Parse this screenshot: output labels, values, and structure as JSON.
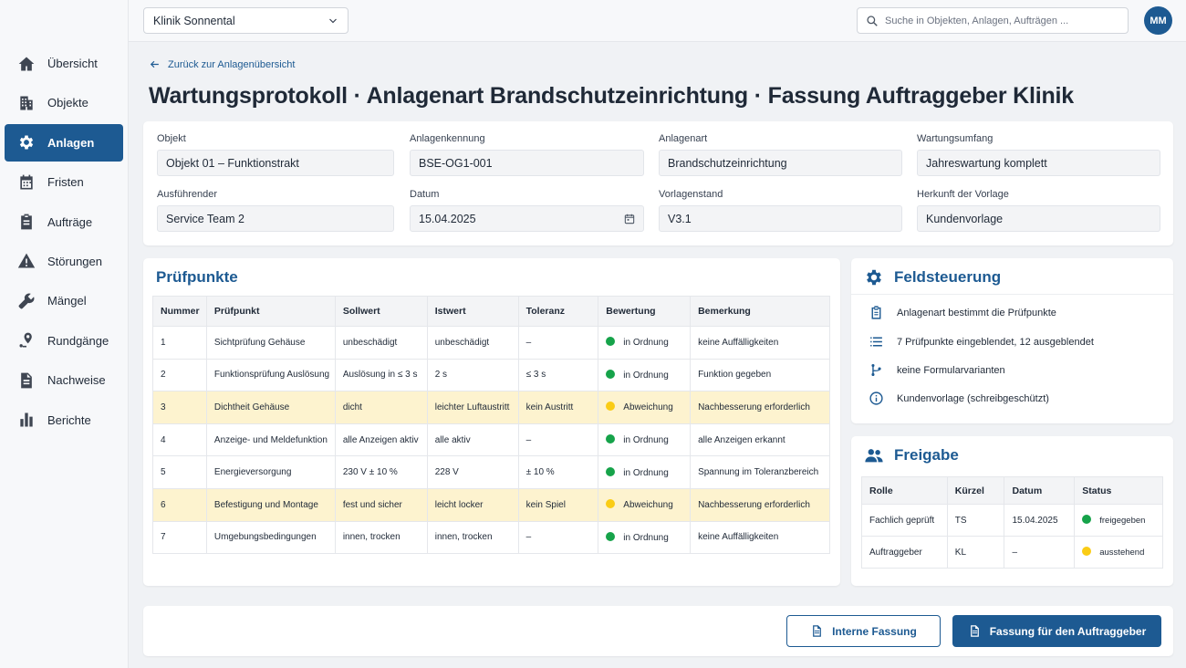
{
  "topbar": {
    "clinic": "Klinik Sonnental",
    "search_placeholder": "Suche in Objekten, Anlagen, Aufträgen ...",
    "avatar_initials": "MM"
  },
  "sidebar": {
    "items": [
      {
        "label": "Übersicht",
        "icon": "home-icon"
      },
      {
        "label": "Objekte",
        "icon": "building-icon"
      },
      {
        "label": "Anlagen",
        "icon": "gear-icon",
        "active": true
      },
      {
        "label": "Fristen",
        "icon": "calendar-icon"
      },
      {
        "label": "Aufträge",
        "icon": "clipboard-icon"
      },
      {
        "label": "Störungen",
        "icon": "warning-icon"
      },
      {
        "label": "Mängel",
        "icon": "wrench-icon"
      },
      {
        "label": "Rundgänge",
        "icon": "route-pin-icon"
      },
      {
        "label": "Nachweise",
        "icon": "document-icon"
      },
      {
        "label": "Berichte",
        "icon": "bar-chart-icon"
      }
    ]
  },
  "page": {
    "back_label": "Zurück zur Anlagenübersicht",
    "title": "Wartungsprotokoll · Anlagenart  Brandschutzeinrichtung · Fassung Auftraggeber Klinik"
  },
  "meta": {
    "objekt": {
      "label": "Objekt",
      "value": "Objekt 01 – Funktionstrakt"
    },
    "anlagenkennung": {
      "label": "Anlagenkennung",
      "value": "BSE-OG1-001"
    },
    "anlagenart": {
      "label": "Anlagenart",
      "value": "Brandschutzeinrichtung"
    },
    "wartungsumfang": {
      "label": "Wartungsumfang",
      "value": "Jahreswartung komplett"
    },
    "ausfuehrender": {
      "label": "Ausführender",
      "value": "Service Team 2"
    },
    "datum": {
      "label": "Datum",
      "value": "15.04.2025"
    },
    "vorlagenstand": {
      "label": "Vorlagenstand",
      "value": "V3.1"
    },
    "herkunft": {
      "label": "Herkunft der Vorlage",
      "value": "Kundenvorlage"
    }
  },
  "checks": {
    "title": "Prüfpunkte",
    "columns": [
      "Nummer",
      "Prüfpunkt",
      "Sollwert",
      "Istwert",
      "Toleranz",
      "Bewertung",
      "Bemerkung"
    ],
    "rows": [
      {
        "nr": "1",
        "punkt": "Sichtprüfung Gehäuse",
        "soll": "unbeschädigt",
        "ist": "unbeschädigt",
        "tol": "–",
        "bew": "in Ordnung",
        "status": "ok",
        "bem": "keine Auffälligkeiten"
      },
      {
        "nr": "2",
        "punkt": "Funktionsprüfung Auslösung",
        "soll": "Auslösung in ≤ 3 s",
        "ist": "2 s",
        "tol": "≤ 3 s",
        "bew": "in Ordnung",
        "status": "ok",
        "bem": "Funktion gegeben"
      },
      {
        "nr": "3",
        "punkt": "Dichtheit Gehäuse",
        "soll": "dicht",
        "ist": "leichter Luftaustritt",
        "tol": "kein Austritt",
        "bew": "Abweichung",
        "status": "warn",
        "bem": "Nachbesserung erforderlich"
      },
      {
        "nr": "4",
        "punkt": "Anzeige- und Meldefunktion",
        "soll": "alle Anzeigen aktiv",
        "ist": "alle aktiv",
        "tol": "–",
        "bew": "in Ordnung",
        "status": "ok",
        "bem": "alle Anzeigen erkannt"
      },
      {
        "nr": "5",
        "punkt": "Energieversorgung",
        "soll": "230 V ± 10 %",
        "ist": "228 V",
        "tol": "± 10 %",
        "bew": "in Ordnung",
        "status": "ok",
        "bem": "Spannung im Toleranzbereich"
      },
      {
        "nr": "6",
        "punkt": "Befestigung und Montage",
        "soll": "fest und sicher",
        "ist": "leicht locker",
        "tol": "kein Spiel",
        "bew": "Abweichung",
        "status": "warn",
        "bem": "Nachbesserung erforderlich"
      },
      {
        "nr": "7",
        "punkt": "Umgebungsbedingungen",
        "soll": "innen, trocken",
        "ist": "innen, trocken",
        "tol": "–",
        "bew": "in Ordnung",
        "status": "ok",
        "bem": "keine Auffälligkeiten"
      }
    ]
  },
  "control": {
    "title": "Feldsteuerung",
    "items": [
      {
        "label": "Anlagenart bestimmt die Prüfpunkte",
        "icon": "clipboard-icon"
      },
      {
        "label": "7 Prüfpunkte eingeblendet, 12 ausgeblendet",
        "icon": "list-icon"
      },
      {
        "label": "keine Formularvarianten",
        "icon": "branch-icon"
      },
      {
        "label": "Kundenvorlage (schreibgeschützt)",
        "icon": "info-icon"
      }
    ]
  },
  "release": {
    "title": "Freigabe",
    "columns": [
      "Rolle",
      "Kürzel",
      "Datum",
      "Status"
    ],
    "rows": [
      {
        "rolle": "Fachlich geprüft",
        "kuerzel": "TS",
        "datum": "15.04.2025",
        "status": "freigegeben",
        "state": "ok"
      },
      {
        "rolle": "Auftraggeber",
        "kuerzel": "KL",
        "datum": "–",
        "status": "ausstehend",
        "state": "warn"
      }
    ]
  },
  "actions": {
    "internal": "Interne Fassung",
    "client": "Fassung für den Auftraggeber"
  },
  "colors": {
    "primary": "#1d5a92",
    "ok": "#16a34a",
    "warn": "#facc15",
    "warn_row": "#fdf3cf"
  }
}
